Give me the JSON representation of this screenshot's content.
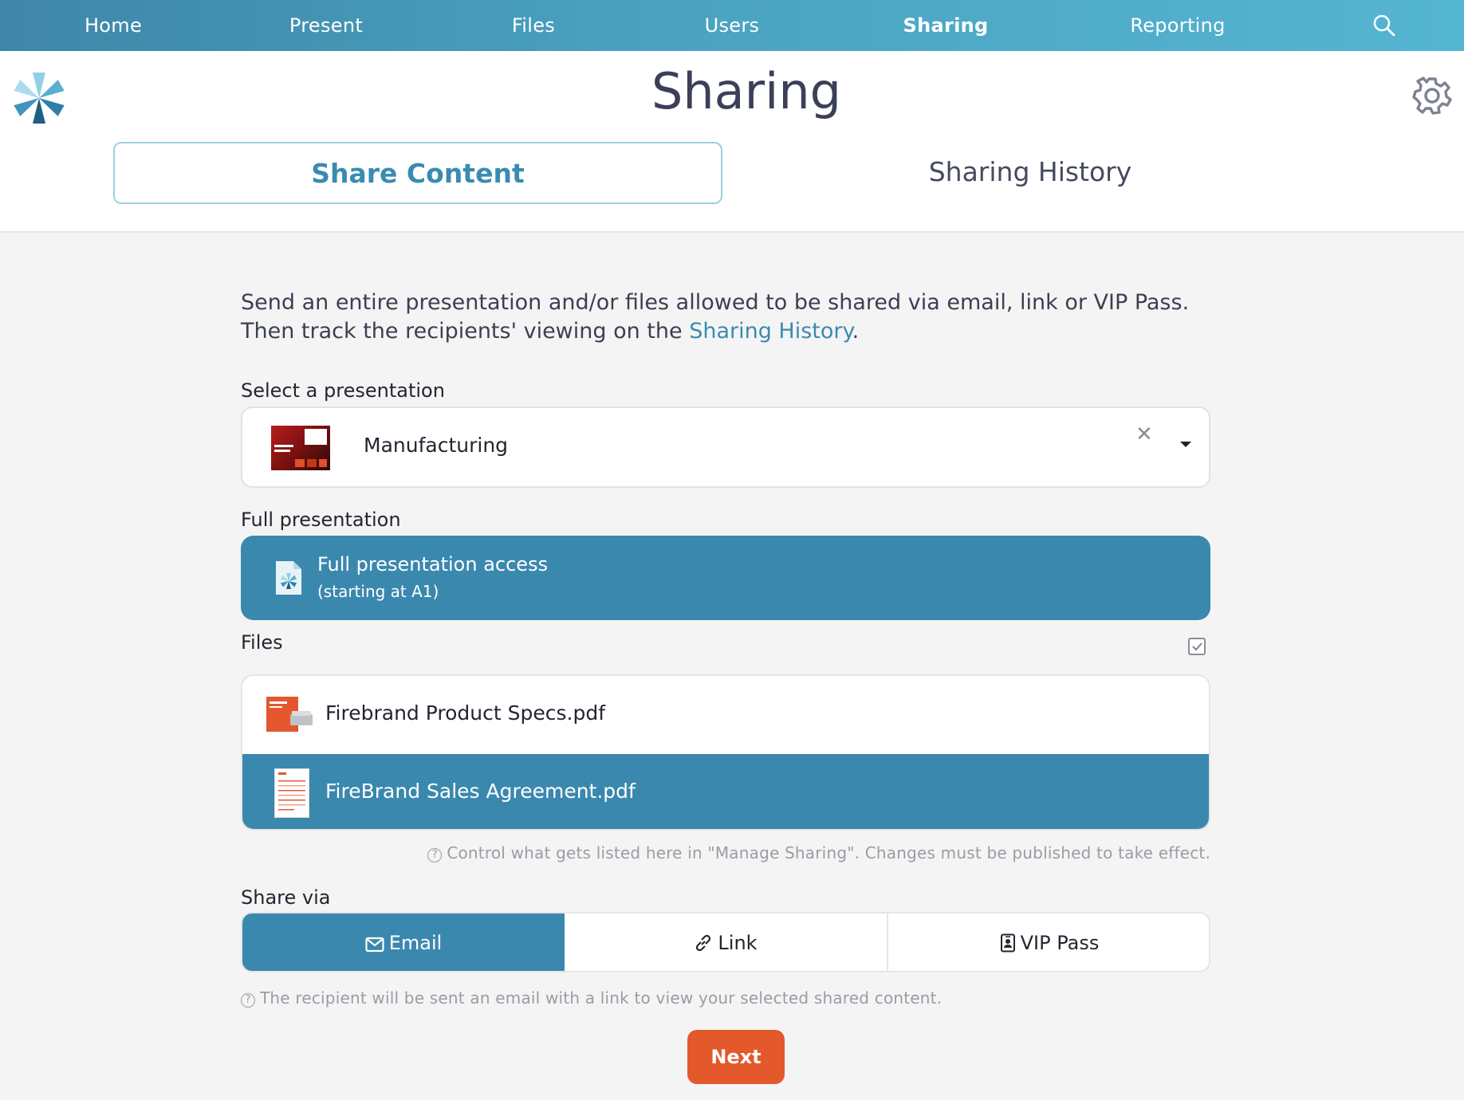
{
  "nav": {
    "items": [
      {
        "label": "Home"
      },
      {
        "label": "Present"
      },
      {
        "label": "Files"
      },
      {
        "label": "Users"
      },
      {
        "label": "Sharing"
      },
      {
        "label": "Reporting"
      }
    ],
    "active": "Sharing",
    "search_icon": "search-icon"
  },
  "header": {
    "title": "Sharing",
    "tabs": [
      {
        "label": "Share Content",
        "selected": true
      },
      {
        "label": "Sharing History",
        "selected": false
      }
    ],
    "settings_icon": "gear-icon"
  },
  "intro": {
    "text_before": "Send an entire presentation and/or files allowed to be shared via email, link or VIP Pass. Then track the recipients' viewing on the ",
    "link": "Sharing History",
    "text_after": "."
  },
  "presentation": {
    "label": "Select a presentation",
    "selected": "Manufacturing"
  },
  "full_presentation": {
    "label": "Full presentation",
    "title": "Full presentation access",
    "subtitle": "(starting at A1)",
    "selected": true
  },
  "files": {
    "label": "Files",
    "select_all_checked": true,
    "items": [
      {
        "name": "Firebrand Product Specs.pdf",
        "selected": false
      },
      {
        "name": "FireBrand Sales Agreement.pdf",
        "selected": true
      }
    ],
    "note": "Control what gets listed here in \"Manage Sharing\". Changes must be published to take effect."
  },
  "share_via": {
    "label": "Share via",
    "options": [
      {
        "label": "Email",
        "icon": "envelope-icon",
        "selected": true
      },
      {
        "label": "Link",
        "icon": "link-icon",
        "selected": false
      },
      {
        "label": "VIP Pass",
        "icon": "badge-icon",
        "selected": false
      }
    ],
    "note": "The recipient will be sent an email with a link to view your selected shared content."
  },
  "actions": {
    "next": "Next"
  },
  "colors": {
    "accent": "#3b88ae",
    "primary_button": "#e3592b",
    "nav_gradient_start": "#3f86a8",
    "nav_gradient_end": "#55b6d2"
  }
}
